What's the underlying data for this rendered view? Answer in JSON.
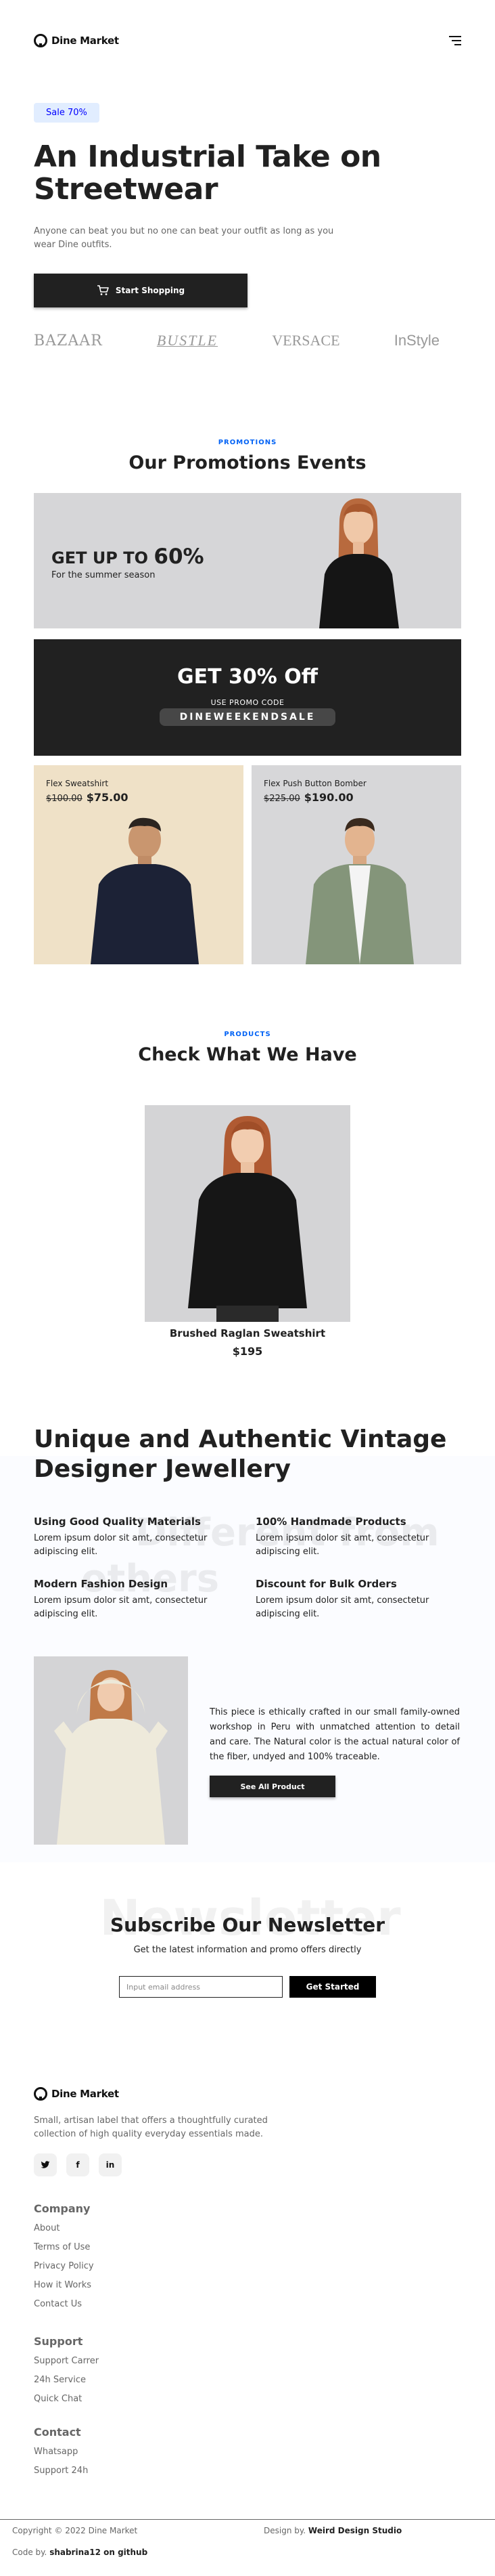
{
  "header": {
    "brand": "Dine Market",
    "menu_icon": "hamburger-menu-icon"
  },
  "hero": {
    "badge": "Sale 70%",
    "title": "An Industrial Take on Streetwear",
    "description": "Anyone can beat you but no one can beat your outfit as long as you wear Dine outfits.",
    "cta": "Start Shopping",
    "cta_icon": "cart-icon",
    "brands": [
      "BAZAAR",
      "BUSTLE",
      "VERSACE",
      "InStyle"
    ]
  },
  "promotions": {
    "eyebrow": "PROMOTIONS",
    "title": "Our Promotions Events",
    "banner1": {
      "prefix": "GET UP TO",
      "percent": "60%",
      "subtitle": "For the summer season"
    },
    "banner2": {
      "title": "GET 30% Off",
      "code_label": "USE PROMO CODE",
      "code": "DINEWEEKENDSALE"
    },
    "cards": [
      {
        "name": "Flex Sweatshirt",
        "old_price": "$100.00",
        "new_price": "$75.00"
      },
      {
        "name": "Flex Push Button Bomber",
        "old_price": "$225.00",
        "new_price": "$190.00"
      }
    ]
  },
  "products": {
    "eyebrow": "PRODUCTS",
    "title": "Check What We Have",
    "items": [
      {
        "name": "Brushed Raglan Sweatshirt",
        "price": "$195"
      }
    ]
  },
  "jewellery": {
    "title": "Unique and Authentic Vintage Designer Jewellery",
    "ghost_text_1": "Different from",
    "ghost_text_2": "others",
    "features": [
      {
        "title": "Using Good Quality Materials",
        "text": "Lorem ipsum dolor sit amt, consectetur adipiscing elit."
      },
      {
        "title": "100% Handmade Products",
        "text": "Lorem ipsum dolor sit amt, consectetur adipiscing elit."
      },
      {
        "title": "Modern Fashion Design",
        "text": "Lorem ipsum dolor sit amt, consectetur adipiscing elit."
      },
      {
        "title": "Discount for Bulk Orders",
        "text": "Lorem ipsum dolor sit amt, consectetur adipiscing elit."
      }
    ],
    "description": "This piece is ethically crafted in our small family-owned workshop in Peru with unmatched attention to detail and care. The Natural color is the actual natural color of the fiber, undyed and 100% traceable.",
    "cta": "See All Product"
  },
  "newsletter": {
    "ghost_text": "Newsletter",
    "title": "Subscribe Our Newsletter",
    "subtitle": "Get the latest information and promo offers directly",
    "input_placeholder": "Input email address",
    "cta": "Get Started"
  },
  "footer": {
    "brand": "Dine Market",
    "tagline": "Small, artisan label that offers a thoughtfully curated collection of high quality everyday essentials made.",
    "socials": [
      {
        "icon": "twitter-icon",
        "glyph": "𝕋"
      },
      {
        "icon": "facebook-icon",
        "glyph": "f"
      },
      {
        "icon": "linkedin-icon",
        "glyph": "in"
      }
    ],
    "company": {
      "heading": "Company",
      "links": [
        "About",
        "Terms of Use",
        "Privacy Policy",
        "How it Works",
        "Contact Us"
      ]
    },
    "support": {
      "heading": "Support",
      "links": [
        "Support Carrer",
        "24h Service",
        "Quick Chat"
      ]
    },
    "contact": {
      "heading": "Contact",
      "links": [
        "Whatsapp",
        "Support 24h"
      ]
    },
    "copyright": "Copyright © 2022 Dine Market",
    "design_label": "Design by.",
    "design_name": "Weird Design Studio",
    "code_label": "Code by.",
    "code_name": "shabrina12 on github"
  }
}
